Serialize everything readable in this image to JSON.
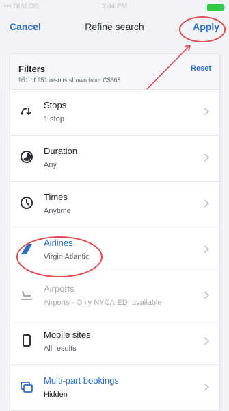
{
  "status": {
    "carrier": "••• DIALOG",
    "time": "3:44 PM"
  },
  "nav": {
    "cancel_label": "Cancel",
    "title": "Refine search",
    "apply_label": "Apply"
  },
  "filters": {
    "title": "Filters",
    "subtitle": "951 of 951 results shown from C$668",
    "reset_label": "Reset",
    "items": [
      {
        "label": "Stops",
        "value": "1 stop",
        "icon": "stops-icon"
      },
      {
        "label": "Duration",
        "value": "Any",
        "icon": "duration-icon"
      },
      {
        "label": "Times",
        "value": "Anytime",
        "icon": "clock-icon"
      },
      {
        "label": "Airlines",
        "value": "Virgin Atlantic",
        "icon": "airline-tail-icon"
      },
      {
        "label": "Airports",
        "value": "Airports - Only NYCA-EDI available",
        "icon": "airport-icon"
      },
      {
        "label": "Mobile sites",
        "value": "All results",
        "icon": "mobile-icon"
      },
      {
        "label": "Multi-part bookings",
        "value": "Hidden",
        "icon": "multi-part-icon"
      }
    ]
  },
  "colors": {
    "accent": "#2b6fc7",
    "annotation": "#e5484d"
  }
}
